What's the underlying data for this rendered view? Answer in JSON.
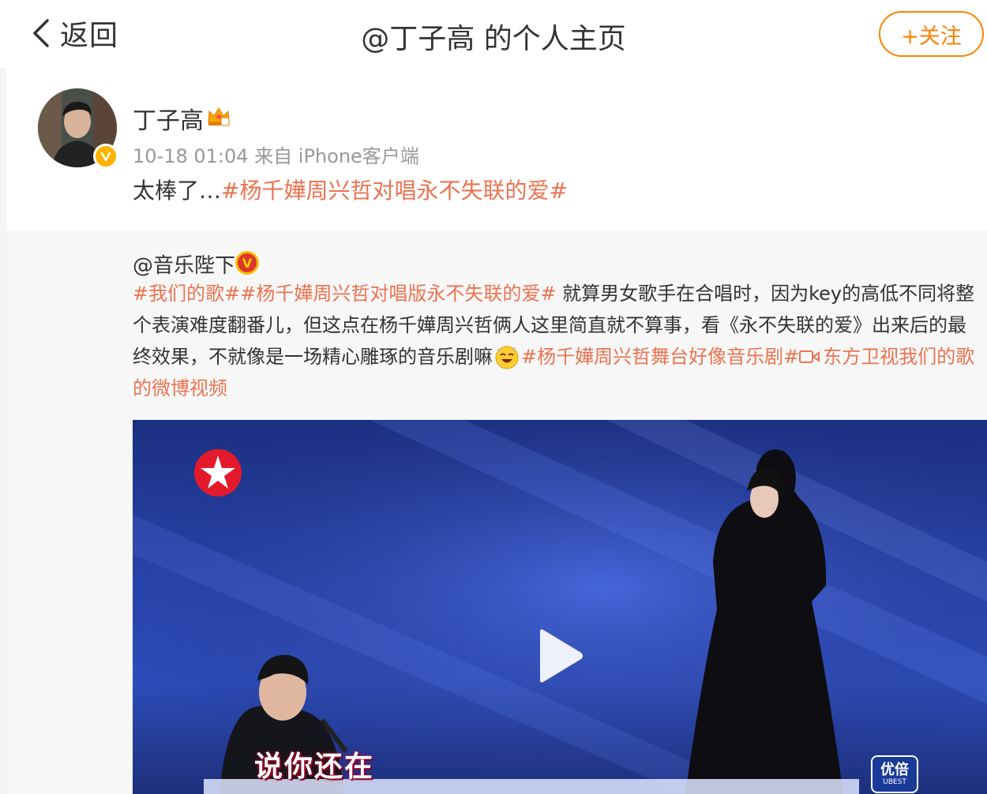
{
  "nav": {
    "back_label": "返回",
    "title": "@丁子高 的个人主页",
    "follow_label": "+关注"
  },
  "post": {
    "author": "丁子高",
    "meta": "10-18 01:04  来自 iPhone客户端",
    "text_plain": "太棒了…",
    "text_topic": "#杨千嬅周兴哲对唱永不失联的爱#"
  },
  "repost": {
    "author": "@音乐陛下",
    "line1_topics": "#我们的歌##杨千嬅周兴哲对唱版永不失联的爱#",
    "line1_text": " 就算男女歌手在合唱时，因为key的高低不同将整",
    "line2_text": "个表演难度翻番儿，但这点在杨千嬅周兴哲俩人这里简直就不算事，看《永不失联的爱》出来后的最",
    "line3_text": "终效果，不就像是一场精心雕琢的音乐剧嘛",
    "line3_topic": "#杨千嬅周兴哲舞台好像音乐剧#",
    "line3_link": "东方卫视我们的歌",
    "line4_link": "的微博视频"
  },
  "video": {
    "subtitle": "说你还在",
    "brand_cn": "优倍",
    "brand_en": "UBEST"
  },
  "colors": {
    "accent_orange": "#ff8200",
    "topic_color": "#eb7350",
    "video_bg": "#2a46b0"
  }
}
